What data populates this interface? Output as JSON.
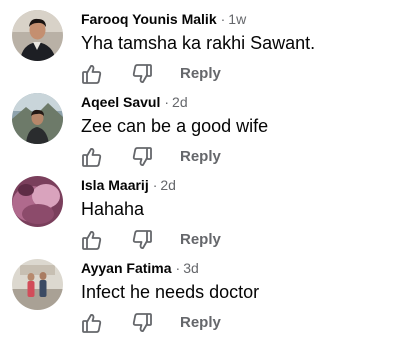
{
  "colors": {
    "author": "#050505",
    "meta": "#65676b",
    "text": "#050505",
    "action": "#65676b"
  },
  "icons": {
    "like": "thumbs-up-icon",
    "dislike": "thumbs-down-icon"
  },
  "comments": [
    {
      "author": "Farooq Younis Malik",
      "separator": "·",
      "time": "1w",
      "text": "Yha tamsha ka rakhi Sawant.",
      "reply_label": "Reply"
    },
    {
      "author": "Aqeel Savul",
      "separator": "·",
      "time": "2d",
      "text": "Zee can be a good wife",
      "reply_label": "Reply"
    },
    {
      "author": "Isla Maarij",
      "separator": "·",
      "time": "2d",
      "text": "Hahaha",
      "reply_label": "Reply"
    },
    {
      "author": "Ayyan Fatima",
      "separator": "·",
      "time": "3d",
      "text": "Infect he needs doctor",
      "reply_label": "Reply"
    }
  ]
}
